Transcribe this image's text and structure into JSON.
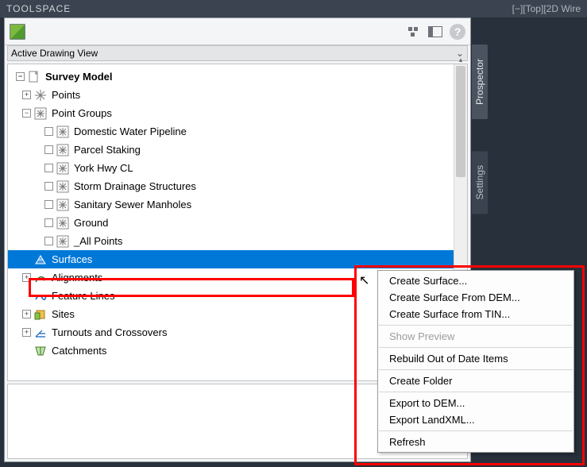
{
  "titlebar": {
    "title": "TOOLSPACE",
    "viewport": "[−][Top][2D Wire"
  },
  "viewbar": {
    "label": "Active Drawing View"
  },
  "side_tabs": [
    {
      "label": "Prospector",
      "active": true
    },
    {
      "label": "Settings",
      "active": false
    }
  ],
  "tree": {
    "root": {
      "label": "Survey Model",
      "expanded": true
    },
    "items": [
      {
        "label": "Points",
        "indent": 1,
        "exp": "+",
        "icon": "points"
      },
      {
        "label": "Point Groups",
        "indent": 1,
        "exp": "-",
        "icon": "pgroup"
      },
      {
        "label": "Domestic Water Pipeline",
        "indent": 2,
        "exp": "box",
        "icon": "pgroup"
      },
      {
        "label": "Parcel Staking",
        "indent": 2,
        "exp": "box",
        "icon": "pgroup"
      },
      {
        "label": "York Hwy CL",
        "indent": 2,
        "exp": "box",
        "icon": "pgroup"
      },
      {
        "label": "Storm Drainage Structures",
        "indent": 2,
        "exp": "box",
        "icon": "pgroup"
      },
      {
        "label": "Sanitary Sewer Manholes",
        "indent": 2,
        "exp": "box",
        "icon": "pgroup"
      },
      {
        "label": "Ground",
        "indent": 2,
        "exp": "box",
        "icon": "pgroup"
      },
      {
        "label": "_All Points",
        "indent": 2,
        "exp": "box",
        "icon": "pgroup"
      },
      {
        "label": "Surfaces",
        "indent": 1,
        "exp": "none",
        "icon": "surface",
        "selected": true
      },
      {
        "label": "Alignments",
        "indent": 1,
        "exp": "+",
        "icon": "align"
      },
      {
        "label": "Feature Lines",
        "indent": 1,
        "exp": "none",
        "icon": "feature"
      },
      {
        "label": "Sites",
        "indent": 1,
        "exp": "+",
        "icon": "sites"
      },
      {
        "label": "Turnouts and Crossovers",
        "indent": 1,
        "exp": "+",
        "icon": "turnout"
      },
      {
        "label": "Catchments",
        "indent": 1,
        "exp": "none",
        "icon": "catch"
      }
    ]
  },
  "context_menu": {
    "groups": [
      [
        {
          "label": "Create Surface..."
        },
        {
          "label": "Create Surface From DEM..."
        },
        {
          "label": "Create Surface from TIN..."
        }
      ],
      [
        {
          "label": "Show Preview",
          "disabled": true
        }
      ],
      [
        {
          "label": "Rebuild Out of Date Items"
        }
      ],
      [
        {
          "label": "Create Folder"
        }
      ],
      [
        {
          "label": "Export to DEM..."
        },
        {
          "label": "Export LandXML..."
        }
      ],
      [
        {
          "label": "Refresh"
        }
      ]
    ]
  }
}
